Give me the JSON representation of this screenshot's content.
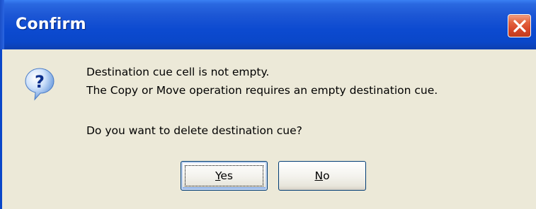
{
  "window": {
    "title": "Confirm"
  },
  "icons": {
    "message_icon": "question-icon",
    "close": "close-icon"
  },
  "message": {
    "line1": "Destination cue cell is not empty.",
    "line2": "The Copy or Move operation requires an empty destination cue.",
    "line3": "Do you want to delete destination cue?"
  },
  "buttons": {
    "yes": {
      "first": "Y",
      "rest": "es"
    },
    "no": {
      "first": "N",
      "rest": "o"
    }
  },
  "colors": {
    "titlebar": "#0a47c9",
    "close_button": "#d8482a",
    "dialog_background": "#ece9d8"
  }
}
